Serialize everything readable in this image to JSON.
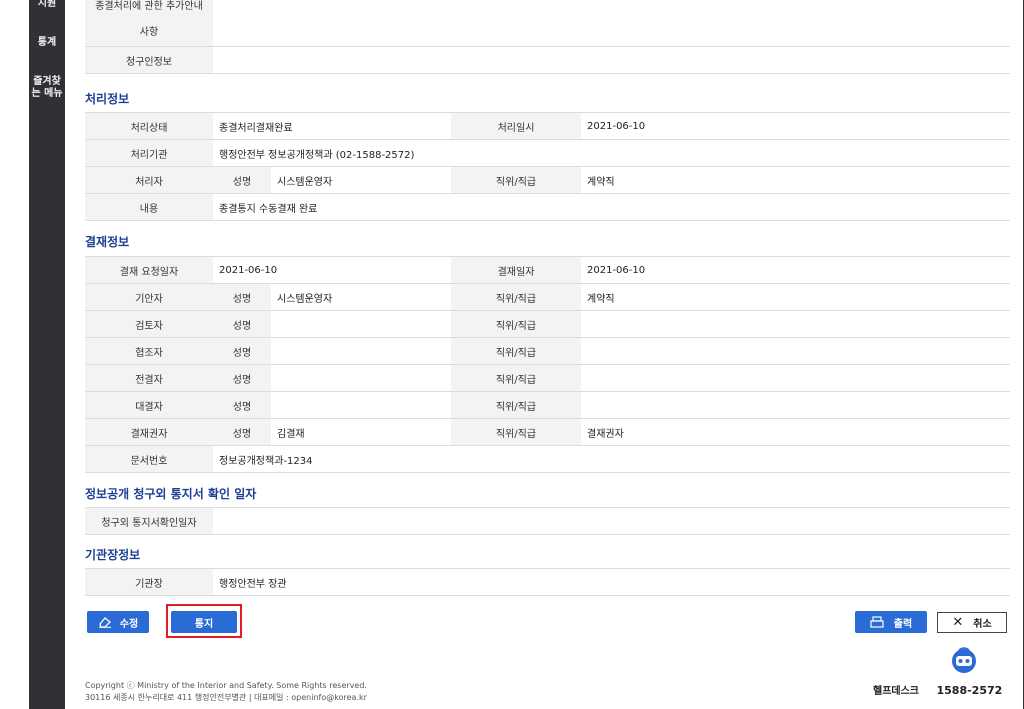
{
  "sidebar": {
    "items": [
      {
        "label": "지원"
      },
      {
        "label": "통계"
      },
      {
        "label": "즐겨찾는 메뉴"
      }
    ]
  },
  "top_rows": [
    {
      "label": "종결처리에 관한 추가안내 사항",
      "value": ""
    },
    {
      "label": "청구인정보",
      "value": ""
    }
  ],
  "sections": {
    "processing": {
      "title": "처리정보",
      "status_label": "처리상태",
      "status_value": "종결처리결재완료",
      "date_label": "처리일시",
      "date_value": "2021-06-10",
      "org_label": "처리기관",
      "org_value": "행정안전부 정보공개정책과 (02-1588-2572)",
      "handler_label": "처리자",
      "name_label": "성명",
      "handler_name": "시스템운영자",
      "position_label": "직위/직급",
      "handler_position": "계약직",
      "content_label": "내용",
      "content_value": "종결통지 수동결재 완료"
    },
    "approval": {
      "title": "결재정보",
      "request_date_label": "결재 요청일자",
      "request_date_value": "2021-06-10",
      "approval_date_label": "결재일자",
      "approval_date_value": "2021-06-10",
      "name_label": "성명",
      "position_label": "직위/직급",
      "rows": [
        {
          "role": "기안자",
          "name": "시스템운영자",
          "position": "계약직"
        },
        {
          "role": "검토자",
          "name": "",
          "position": ""
        },
        {
          "role": "협조자",
          "name": "",
          "position": ""
        },
        {
          "role": "전결자",
          "name": "",
          "position": ""
        },
        {
          "role": "대결자",
          "name": "",
          "position": ""
        },
        {
          "role": "결재권자",
          "name": "김결재",
          "position": "결재권자"
        }
      ],
      "doc_label": "문서번호",
      "doc_value": "정보공개정책과-1234"
    },
    "confirm": {
      "title": "정보공개 청구외 통지서 확인 일자",
      "label": "청구외 통지서확인일자",
      "value": ""
    },
    "agency": {
      "title": "기관장정보",
      "label": "기관장",
      "value": "행정안전부 장관"
    }
  },
  "buttons": {
    "edit": "수정",
    "notify": "통지",
    "print": "출력",
    "cancel": "취소"
  },
  "footer": {
    "copyright": "Copyright ⓒ Ministry of the Interior and Safety. Some Rights reserved.",
    "address": "30116 세종시 한누리대로 411 행정안전부별관 | 대표메일 : openinfo@korea.kr",
    "helpdesk_label": "헬프데스크",
    "helpdesk_number": "1588-2572"
  }
}
